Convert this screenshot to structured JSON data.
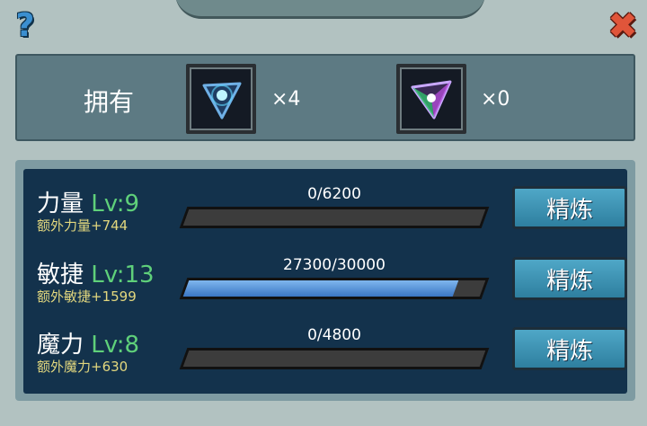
{
  "header": {
    "help_icon": "question-mark-icon",
    "close_icon": "close-x-icon",
    "help_glyph": "?",
    "close_glyph": "✖"
  },
  "ownership": {
    "label": "拥有",
    "items": [
      {
        "icon": "blue-crystal-gem-icon",
        "count": "×4"
      },
      {
        "icon": "rainbow-crystal-gem-icon",
        "count": "×0"
      }
    ]
  },
  "stats": [
    {
      "name": "力量",
      "level": "Lv:9",
      "bonus": "额外力量+744",
      "progress": "0/6200",
      "fill_fraction": 0.0,
      "button": "精炼"
    },
    {
      "name": "敏捷",
      "level": "Lv:13",
      "bonus": "额外敏捷+1599",
      "progress": "27300/30000",
      "fill_fraction": 0.91,
      "button": "精炼"
    },
    {
      "name": "魔力",
      "level": "Lv:8",
      "bonus": "额外魔力+630",
      "progress": "0/4800",
      "fill_fraction": 0.0,
      "button": "精炼"
    }
  ]
}
